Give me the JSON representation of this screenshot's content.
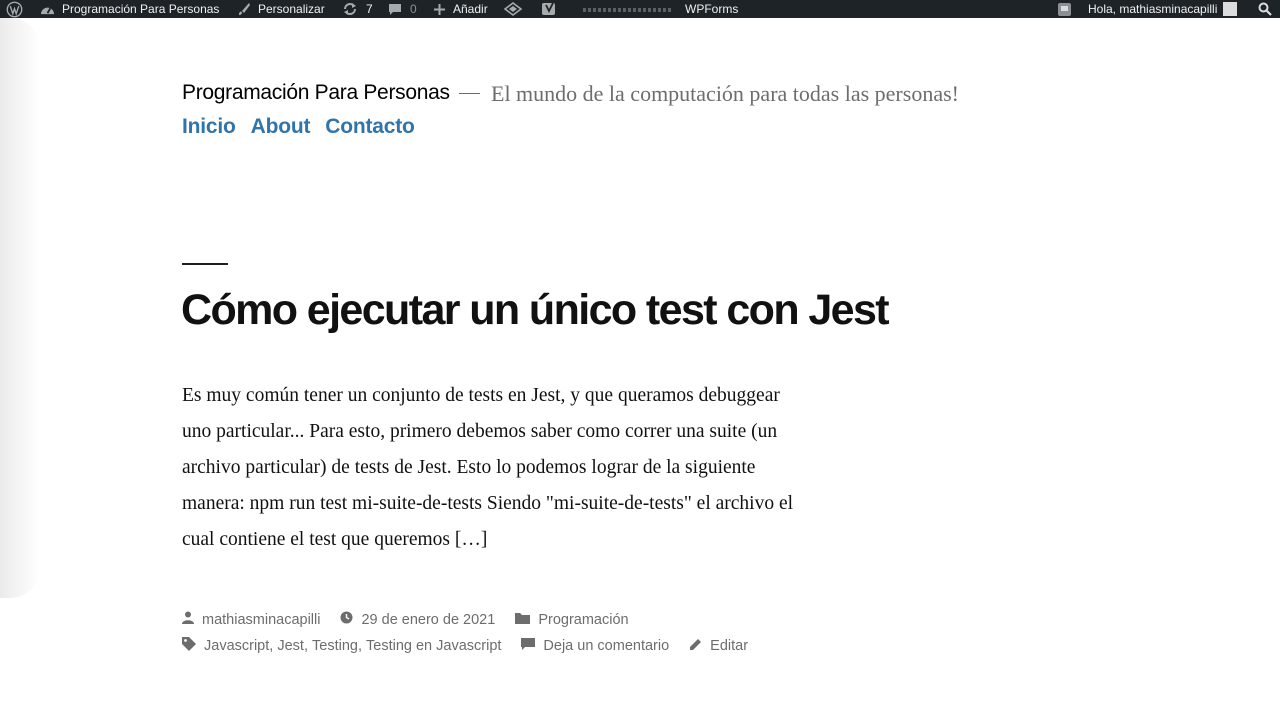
{
  "adminbar": {
    "site_name": "Programación Para Personas",
    "customize": "Personalizar",
    "updates_count": "7",
    "comments_count": "0",
    "add_new": "Añadir",
    "wpforms": "WPForms",
    "greeting": "Hola, mathiasminacapilli"
  },
  "header": {
    "site_title": "Programación Para Personas",
    "tagline": "El mundo de la computación para todas las personas!",
    "nav": [
      "Inicio",
      "About",
      "Contacto"
    ]
  },
  "post": {
    "title": "Cómo ejecutar un único test con Jest",
    "excerpt": "Es muy común tener un conjunto de tests en Jest, y que queramos debuggear uno particular... Para esto, primero debemos saber como correr una suite (un archivo particular) de tests de Jest. Esto lo podemos lograr de la siguiente manera: npm run test mi-suite-de-tests Siendo \"mi-suite-de-tests\" el archivo el cual contiene el test que queremos […]",
    "author": "mathiasminacapilli",
    "date": "29 de enero de 2021",
    "category": "Programación",
    "tags": [
      "Javascript",
      "Jest",
      "Testing",
      "Testing en Javascript"
    ],
    "comment_link": "Deja un comentario",
    "edit_link": "Editar"
  },
  "colors": {
    "adminbar_bg": "#1d2327",
    "link_blue": "#3174a9",
    "meta_gray": "#6d6d6d"
  }
}
